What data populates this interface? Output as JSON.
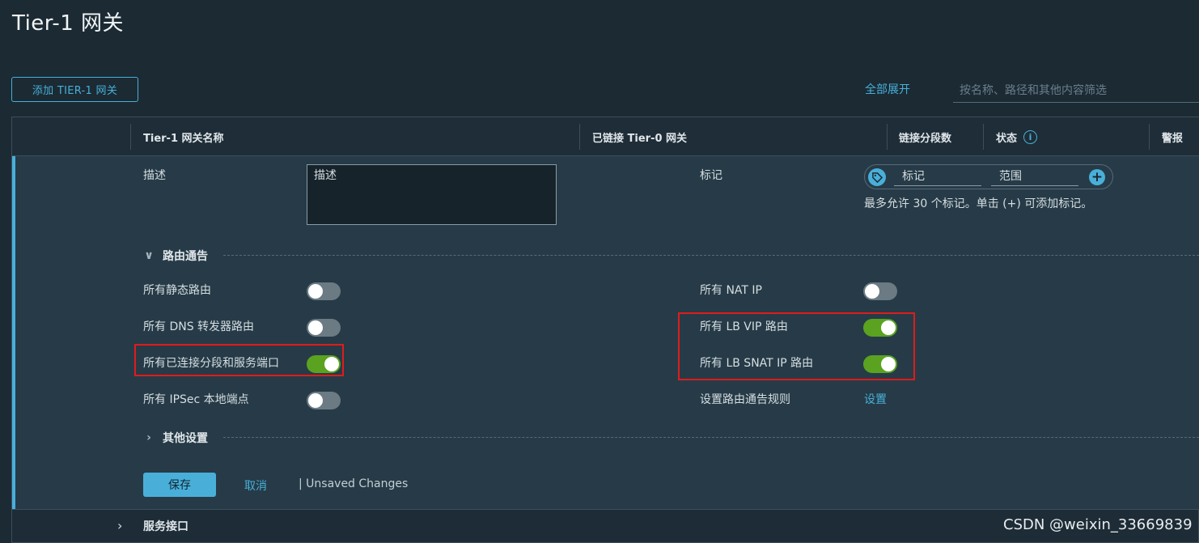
{
  "page": {
    "title": "Tier-1 网关"
  },
  "toolbar": {
    "add_label": "添加 TIER-1 网关",
    "expand_all": "全部展开",
    "filter_placeholder": "按名称、路径和其他内容筛选"
  },
  "table": {
    "columns": [
      "Tier-1 网关名称",
      "已链接 Tier-0 网关",
      "链接分段数",
      "状态",
      "警报"
    ]
  },
  "detail": {
    "description_label": "描述",
    "description_placeholder": "描述",
    "tags_label": "标记",
    "tag_field": "标记",
    "scope_field": "范围",
    "tags_hint": "最多允许 30 个标记。单击 (+) 可添加标记。",
    "route_ads_section": "路由通告",
    "other_settings_section": "其他设置",
    "left_toggles": [
      {
        "label": "所有静态路由",
        "on": false
      },
      {
        "label": "所有 DNS 转发器路由",
        "on": false
      },
      {
        "label": "所有已连接分段和服务端口",
        "on": true
      },
      {
        "label": "所有 IPSec 本地端点",
        "on": false
      }
    ],
    "right_toggles": [
      {
        "label": "所有 NAT IP",
        "on": false
      },
      {
        "label": "所有 LB VIP 路由",
        "on": true
      },
      {
        "label": "所有 LB SNAT IP 路由",
        "on": true
      }
    ],
    "rules_label": "设置路由通告规则",
    "rules_link": "设置",
    "save": "保存",
    "cancel": "取消",
    "unsaved": "| Unsaved Changes"
  },
  "next_row": {
    "label": "服务接口"
  },
  "watermark": "CSDN @weixin_33669839",
  "colors": {
    "accent": "#49afd9",
    "toggle_on": "#5aa220",
    "toggle_off": "#6b7a83",
    "highlight": "#e01b1b"
  }
}
